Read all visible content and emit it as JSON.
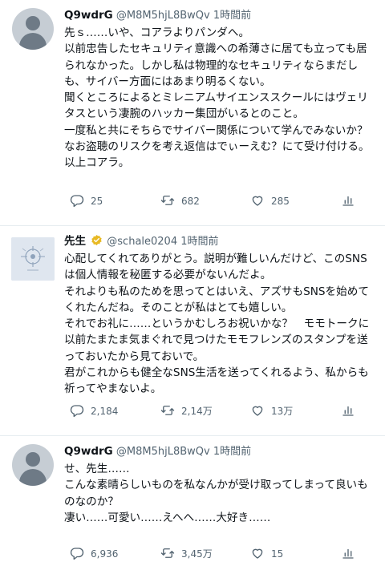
{
  "tweets": [
    {
      "display_name": "Q9wdrG",
      "handle": "@M8M5hjL8BwQv",
      "time": "1時間前",
      "text": "先ｓ……いや、コアラよりパンダへ。\n以前忠告したセキュリティ意識への希薄さに居ても立っても居られなかった。しかし私は物理的なセキュリティならまだしも、サイバー方面にはあまり明るくない。\n聞くところによるとミレニアムサイエンススクールにはヴェリタスという凄腕のハッカー集団がいるとのこと。\n一度私と共にそちらでサイバー関係について学んでみないか？　なお盗聴のリスクを考え返信はでぃーえむ？にて受け付ける。\n以上コアラ。",
      "replies": "25",
      "retweets": "682",
      "likes": "285"
    },
    {
      "display_name": "先生",
      "handle": "@schale0204",
      "time": "1時間前",
      "text": "心配してくれてありがとう。説明が難しいんだけど、このSNSは個人情報を秘匿する必要がないんだよ。\nそれよりも私のためを思ってとはいえ、アズサもSNSを始めてくれたんだね。そのことが私はとても嬉しい。\nそれでお礼に……というかむしろお祝いかな？　モモトークに以前たまたま気まぐれで見つけたモモフレンズのスタンプを送っておいたから見ておいで。\n君がこれからも健全なSNS生活を送ってくれるよう、私からも祈ってやまないよ。",
      "replies": "2,184",
      "retweets": "2,14万",
      "likes": "13万"
    },
    {
      "display_name": "Q9wdrG",
      "handle": "@M8M5hjL8BwQv",
      "time": "1時間前",
      "text": "せ、先生……\nこんな素晴らしいものを私なんかが受け取ってしまって良いものなのか？\n凄い……可愛い……えへへ……大好き……",
      "replies": "6,936",
      "retweets": "3,45万",
      "likes": "15"
    }
  ],
  "icons": {
    "reply": "reply-icon",
    "retweet": "retweet-icon",
    "like": "heart-icon",
    "share": "analytics-icon",
    "verified": "verified-badge-icon",
    "avatar_default": "default-avatar-icon"
  },
  "colors": {
    "text": "#0f1419",
    "secondary": "#536471",
    "divider": "#e6ecf0",
    "verified_gold": "#e8b923"
  }
}
